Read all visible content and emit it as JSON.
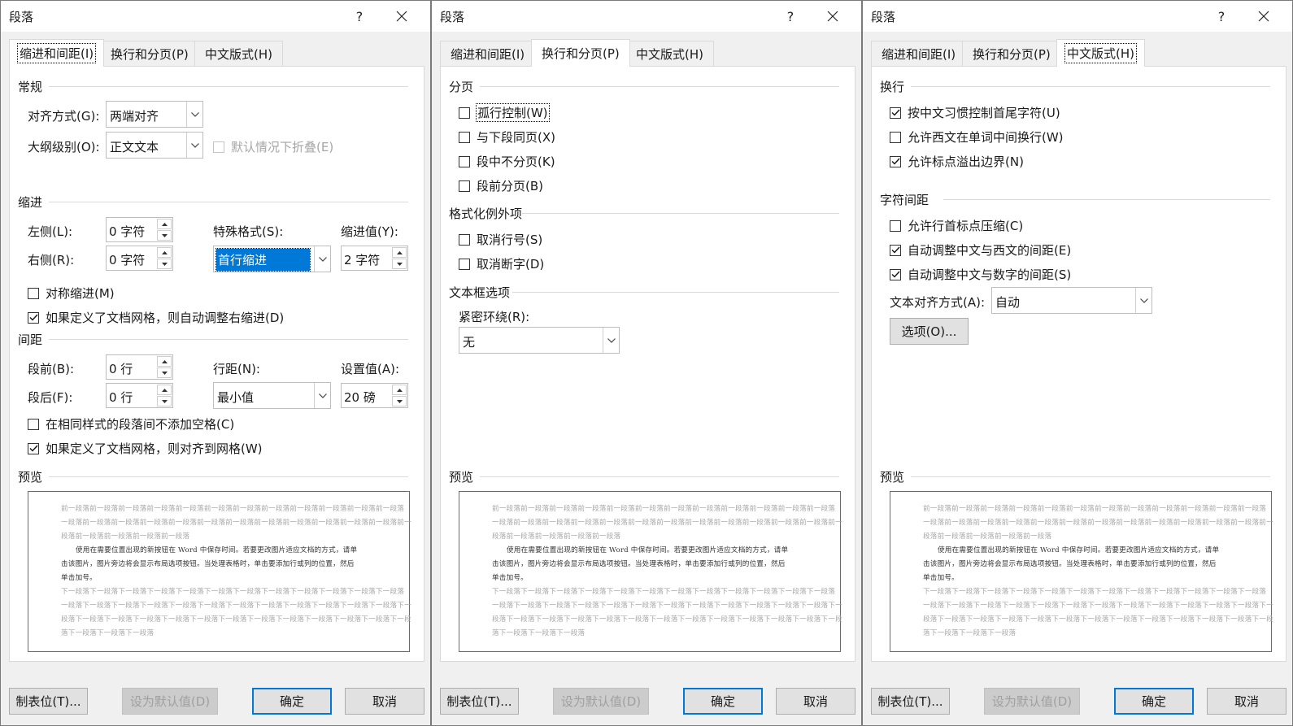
{
  "dialog": {
    "title": "段落",
    "help": "?",
    "tabs": [
      "缩进和间距(I)",
      "换行和分页(P)",
      "中文版式(H)"
    ]
  },
  "indent_tab": {
    "general_title": "常规",
    "alignment_label": "对齐方式(G):",
    "alignment_value": "两端对齐",
    "outline_label": "大纲级别(O):",
    "outline_value": "正文文本",
    "collapse_label": "默认情况下折叠(E)",
    "indent_title": "缩进",
    "left_label": "左侧(L):",
    "left_value": "0 字符",
    "right_label": "右侧(R):",
    "right_value": "0 字符",
    "special_label": "特殊格式(S):",
    "special_value": "首行缩进",
    "indent_by_label": "缩进值(Y):",
    "indent_by_value": "2 字符",
    "mirror_label": "对称缩进(M)",
    "auto_right_label": "如果定义了文档网格，则自动调整右缩进(D)",
    "spacing_title": "间距",
    "before_label": "段前(B):",
    "before_value": "0 行",
    "after_label": "段后(F):",
    "after_value": "0 行",
    "line_spacing_label": "行距(N):",
    "line_spacing_value": "最小值",
    "at_label": "设置值(A):",
    "at_value": "20 磅",
    "no_space_label": "在相同样式的段落间不添加空格(C)",
    "snap_grid_label": "如果定义了文档网格，则对齐到网格(W)",
    "checks": {
      "mirror": false,
      "auto_right": true,
      "no_space": false,
      "snap_grid": true
    }
  },
  "linebreak_tab": {
    "pagination_title": "分页",
    "widow_label": "孤行控制(W)",
    "keep_next_label": "与下段同页(X)",
    "keep_lines_label": "段中不分页(K)",
    "page_break_label": "段前分页(B)",
    "exceptions_title": "格式化例外项",
    "suppress_ln_label": "取消行号(S)",
    "no_hyphen_label": "取消断字(D)",
    "textbox_title": "文本框选项",
    "tight_wrap_label": "紧密环绕(R):",
    "tight_wrap_value": "无"
  },
  "asian_tab": {
    "linebreak_title": "换行",
    "chinese_rules_label": "按中文习惯控制首尾字符(U)",
    "latin_wrap_label": "允许西文在单词中间换行(W)",
    "hanging_punct_label": "允许标点溢出边界(N)",
    "char_spacing_title": "字符间距",
    "compress_punct_label": "允许行首标点压缩(C)",
    "auto_asian_latin_label": "自动调整中文与西文的间距(E)",
    "auto_asian_num_label": "自动调整中文与数字的间距(S)",
    "text_align_label": "文本对齐方式(A):",
    "text_align_value": "自动",
    "options_button": "选项(O)...",
    "checks": {
      "chinese_rules": true,
      "latin_wrap": false,
      "hanging_punct": true,
      "compress_punct": false,
      "auto_asian_latin": true,
      "auto_asian_num": true
    }
  },
  "preview": {
    "title": "预览",
    "prev_lines": [
      "前一段落前一段落前一段落前一段落前一段落前一段落前一段落前一段落前一段落前一段落前一段落前一段落",
      "一段落前一段落前一段落前一段落前一段落前一段落前一段落前一段落前一段落前一段落前一段落前一段落前一",
      "段落前一段落前一段落前一段落前一段落"
    ],
    "sample_lines": [
      "使用在需要位置出现的新按钮在 Word 中保存时间。若要更改图片适应文档的方式，请单",
      "击该图片，图片旁边将会显示布局选项按钮。当处理表格时，单击要添加行或列的位置，然后",
      "单击加号。"
    ],
    "next_lines": [
      "下一段落下一段落下一段落下一段落下一段落下一段落下一段落下一段落下一段落下一段落下一段落下一段落",
      "一段落下一段落下一段落下一段落下一段落下一段落下一段落下一段落下一段落下一段落下一段落下一段落下一",
      "段落下一段落下一段落下一段落下一段落下一段落下一段落下一段落下一段落下一段落下一段落下一段落下一段",
      "落下一段落下一段落下一段落"
    ]
  },
  "footer": {
    "tabs_button": "制表位(T)...",
    "default_button": "设为默认值(D)",
    "ok_button": "确定",
    "cancel_button": "取消"
  }
}
